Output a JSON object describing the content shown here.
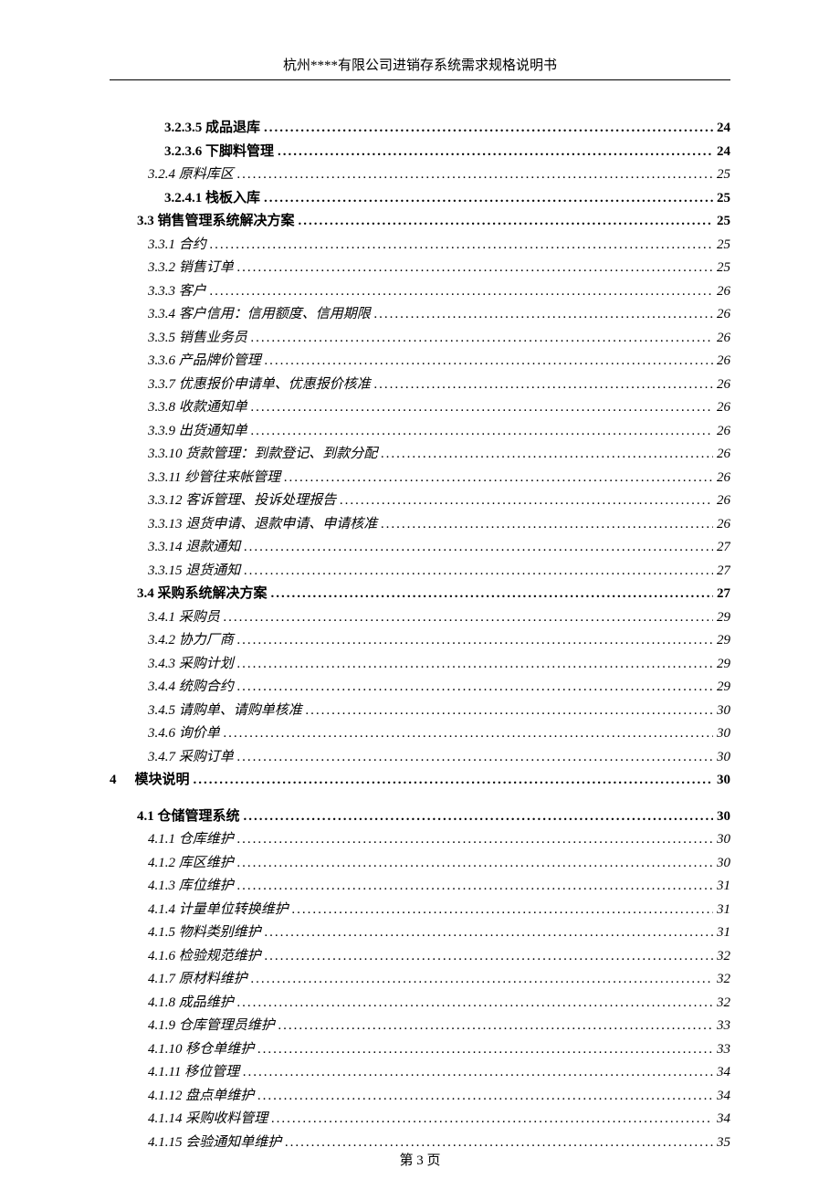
{
  "header": {
    "title": "杭州****有限公司进销存系统需求规格说明书"
  },
  "toc": [
    {
      "label": "3.2.3.5 成品退库",
      "page": "24",
      "indent": 3,
      "style": "bold"
    },
    {
      "label": "3.2.3.6 下脚料管理",
      "page": "24",
      "indent": 3,
      "style": "bold"
    },
    {
      "label": "3.2.4 原料库区",
      "page": "25",
      "indent": 2,
      "style": "italic"
    },
    {
      "label": "3.2.4.1 栈板入库",
      "page": "25",
      "indent": 3,
      "style": "bold"
    },
    {
      "label": "3.3 销售管理系统解决方案",
      "page": "25",
      "indent": 1,
      "style": "bold"
    },
    {
      "label": "3.3.1 合约",
      "page": "25",
      "indent": 2,
      "style": "italic"
    },
    {
      "label": "3.3.2 销售订单",
      "page": "25",
      "indent": 2,
      "style": "italic"
    },
    {
      "label": "3.3.3 客户",
      "page": "26",
      "indent": 2,
      "style": "italic"
    },
    {
      "label": "3.3.4 客户信用：信用额度、信用期限",
      "page": "26",
      "indent": 2,
      "style": "italic"
    },
    {
      "label": "3.3.5 销售业务员",
      "page": "26",
      "indent": 2,
      "style": "italic"
    },
    {
      "label": "3.3.6 产品牌价管理",
      "page": "26",
      "indent": 2,
      "style": "italic"
    },
    {
      "label": "3.3.7 优惠报价申请单、优惠报价核准",
      "page": "26",
      "indent": 2,
      "style": "italic"
    },
    {
      "label": "3.3.8 收款通知单",
      "page": "26",
      "indent": 2,
      "style": "italic"
    },
    {
      "label": "3.3.9 出货通知单",
      "page": "26",
      "indent": 2,
      "style": "italic"
    },
    {
      "label": "3.3.10 货款管理：到款登记、到款分配",
      "page": "26",
      "indent": 2,
      "style": "italic"
    },
    {
      "label": "3.3.11 纱管往来帐管理",
      "page": "26",
      "indent": 2,
      "style": "italic"
    },
    {
      "label": "3.3.12 客诉管理、投诉处理报告",
      "page": "26",
      "indent": 2,
      "style": "italic"
    },
    {
      "label": "3.3.13 退货申请、退款申请、申请核准",
      "page": "26",
      "indent": 2,
      "style": "italic"
    },
    {
      "label": "3.3.14 退款通知",
      "page": "27",
      "indent": 2,
      "style": "italic"
    },
    {
      "label": "3.3.15 退货通知",
      "page": "27",
      "indent": 2,
      "style": "italic"
    },
    {
      "label": "3.4 采购系统解决方案",
      "page": "27",
      "indent": 1,
      "style": "bold"
    },
    {
      "label": "3.4.1 采购员",
      "page": "29",
      "indent": 2,
      "style": "italic"
    },
    {
      "label": "3.4.2 协力厂商",
      "page": "29",
      "indent": 2,
      "style": "italic"
    },
    {
      "label": "3.4.3 采购计划",
      "page": "29",
      "indent": 2,
      "style": "italic"
    },
    {
      "label": "3.4.4 统购合约",
      "page": "29",
      "indent": 2,
      "style": "italic"
    },
    {
      "label": "3.4.5 请购单、请购单核准",
      "page": "30",
      "indent": 2,
      "style": "italic"
    },
    {
      "label": "3.4.6 询价单",
      "page": "30",
      "indent": 2,
      "style": "italic"
    },
    {
      "label": "3.4.7 采购订单",
      "page": "30",
      "indent": 2,
      "style": "italic"
    },
    {
      "type": "chapter",
      "num": "4",
      "label": "模块说明",
      "page": "30",
      "indent": 0,
      "style": "bold"
    },
    {
      "type": "spacer"
    },
    {
      "label": "4.1 仓储管理系统",
      "page": "30",
      "indent": 1,
      "style": "bold"
    },
    {
      "label": "4.1.1 仓库维护",
      "page": "30",
      "indent": 2,
      "style": "italic"
    },
    {
      "label": "4.1.2 库区维护",
      "page": "30",
      "indent": 2,
      "style": "italic"
    },
    {
      "label": "4.1.3 库位维护",
      "page": "31",
      "indent": 2,
      "style": "italic"
    },
    {
      "label": "4.1.4 计量单位转换维护",
      "page": "31",
      "indent": 2,
      "style": "italic"
    },
    {
      "label": "4.1.5 物料类别维护",
      "page": "31",
      "indent": 2,
      "style": "italic"
    },
    {
      "label": "4.1.6 检验规范维护",
      "page": "32",
      "indent": 2,
      "style": "italic"
    },
    {
      "label": "4.1.7 原材料维护",
      "page": "32",
      "indent": 2,
      "style": "italic"
    },
    {
      "label": "4.1.8 成品维护",
      "page": "32",
      "indent": 2,
      "style": "italic"
    },
    {
      "label": "4.1.9 仓库管理员维护",
      "page": "33",
      "indent": 2,
      "style": "italic"
    },
    {
      "label": "4.1.10 移仓单维护",
      "page": "33",
      "indent": 2,
      "style": "italic"
    },
    {
      "label": "4.1.11 移位管理",
      "page": "34",
      "indent": 2,
      "style": "italic"
    },
    {
      "label": "4.1.12 盘点单维护",
      "page": "34",
      "indent": 2,
      "style": "italic"
    },
    {
      "label": "4.1.14 采购收料管理",
      "page": "34",
      "indent": 2,
      "style": "italic"
    },
    {
      "label": "4.1.15 会验通知单维护",
      "page": "35",
      "indent": 2,
      "style": "italic"
    }
  ],
  "footer": {
    "text": "第 3 页"
  }
}
